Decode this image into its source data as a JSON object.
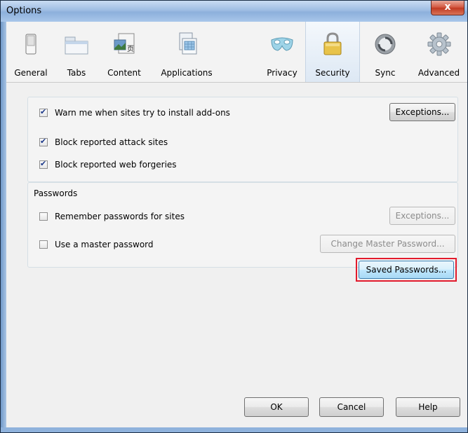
{
  "window": {
    "title": "Options",
    "close_glyph": "x"
  },
  "tabs": [
    {
      "label": "General",
      "icon": "switch-icon"
    },
    {
      "label": "Tabs",
      "icon": "tabs-icon"
    },
    {
      "label": "Content",
      "icon": "content-icon"
    },
    {
      "label": "Applications",
      "icon": "applications-icon"
    },
    {
      "label": "Privacy",
      "icon": "mask-icon"
    },
    {
      "label": "Security",
      "icon": "padlock-icon",
      "selected": true
    },
    {
      "label": "Sync",
      "icon": "sync-icon"
    },
    {
      "label": "Advanced",
      "icon": "gear-icon"
    }
  ],
  "security": {
    "warn_addons": {
      "label": "Warn me when sites try to install add-ons",
      "checked": true
    },
    "exceptions_label": "Exceptions...",
    "block_attack": {
      "label": "Block reported attack sites",
      "checked": true
    },
    "block_forgeries": {
      "label": "Block reported web forgeries",
      "checked": true
    }
  },
  "passwords": {
    "legend": "Passwords",
    "remember": {
      "label": "Remember passwords for sites",
      "checked": false
    },
    "exceptions_label": "Exceptions...",
    "master": {
      "label": "Use a master password",
      "checked": false
    },
    "change_master_label": "Change Master Password...",
    "saved_passwords_label": "Saved Passwords..."
  },
  "footer": {
    "ok": "OK",
    "cancel": "Cancel",
    "help": "Help"
  },
  "colors": {
    "highlight_border": "#e21a2c",
    "title_bar": "#9fbde3"
  }
}
